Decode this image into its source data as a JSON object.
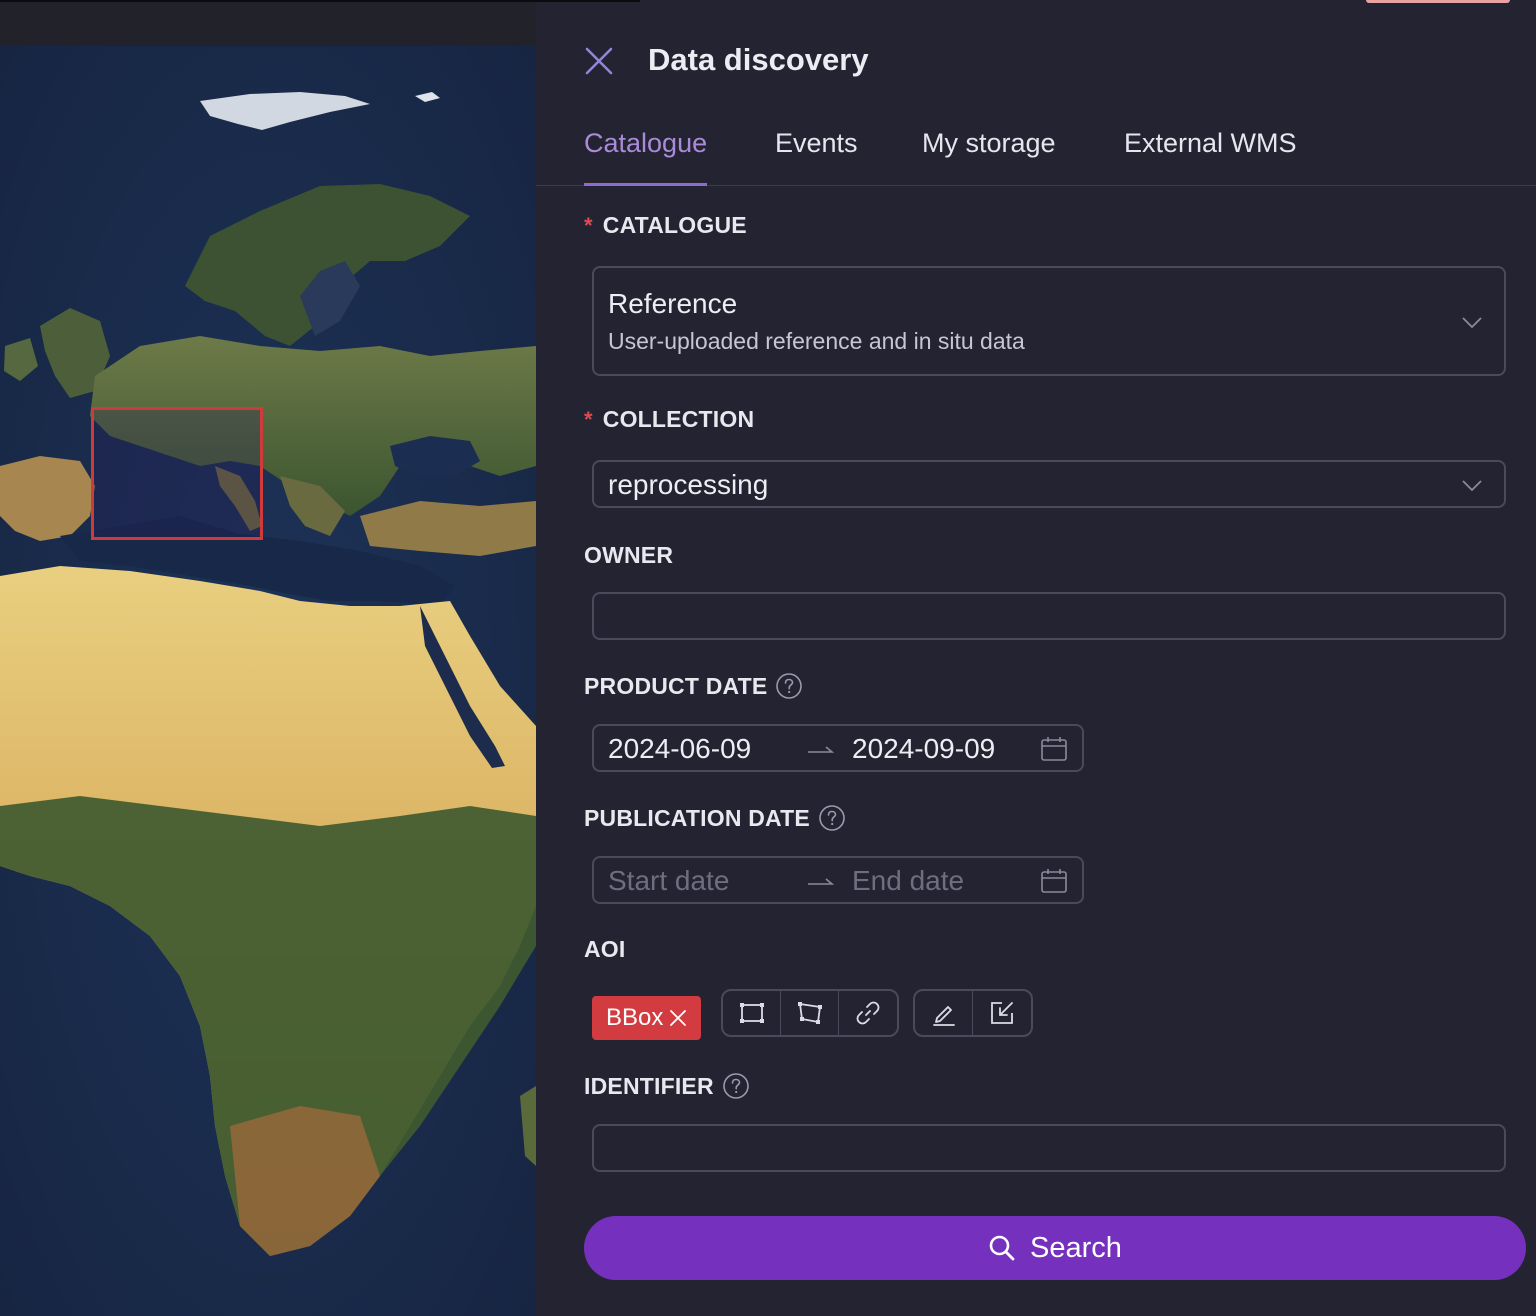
{
  "header": {
    "title": "Data discovery"
  },
  "tabs": [
    {
      "label": "Catalogue",
      "active": true
    },
    {
      "label": "Events",
      "active": false
    },
    {
      "label": "My storage",
      "active": false
    },
    {
      "label": "External WMS",
      "active": false
    }
  ],
  "form": {
    "catalogue": {
      "label": "CATALOGUE",
      "required_mark": "*",
      "value": "Reference",
      "description": "User-uploaded reference and in situ data"
    },
    "collection": {
      "label": "COLLECTION",
      "required_mark": "*",
      "value": "reprocessing"
    },
    "owner": {
      "label": "OWNER",
      "value": ""
    },
    "product_date": {
      "label": "PRODUCT DATE",
      "start": "2024-06-09",
      "end": "2024-09-09"
    },
    "publication_date": {
      "label": "PUBLICATION DATE",
      "start_placeholder": "Start date",
      "end_placeholder": "End date"
    },
    "aoi": {
      "label": "AOI",
      "tag": "BBox",
      "tools": [
        "bbox-draw-icon",
        "polygon-draw-icon",
        "link-icon",
        "edit-icon",
        "import-icon"
      ]
    },
    "identifier": {
      "label": "IDENTIFIER",
      "value": ""
    },
    "search_label": "Search"
  },
  "colors": {
    "accent": "#8f6ad1",
    "primary_button": "#7531bd",
    "tag_red": "#d23b3f",
    "panel_bg": "#232332",
    "aoi_rect": "#cf3a3a"
  }
}
